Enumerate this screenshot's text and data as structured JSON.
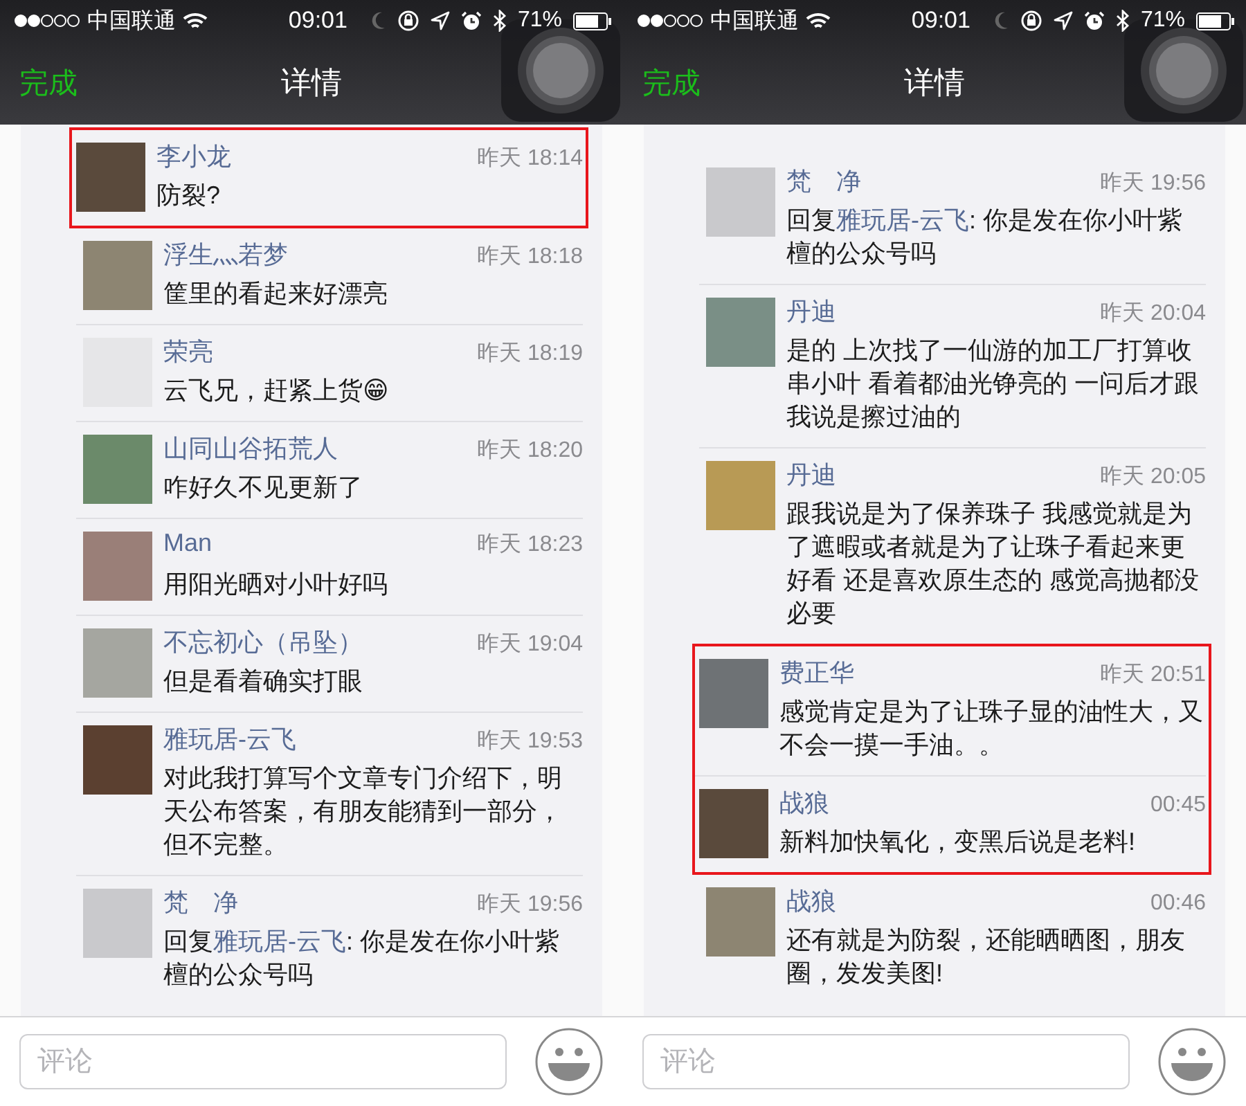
{
  "panels": [
    {
      "status_bar": {
        "carrier": "中国联通",
        "time": "09:01",
        "battery": "71%"
      },
      "nav": {
        "left": "完成",
        "title": "详情"
      },
      "comments": [
        {
          "name": "李小龙",
          "time": "昨天 18:14",
          "text": "防裂?",
          "highlighted": true
        },
        {
          "name": "浮生灬若梦",
          "time": "昨天 18:18",
          "text": "筐里的看起来好漂亮",
          "highlighted": false
        },
        {
          "name": "荣亮",
          "time": "昨天 18:19",
          "text": "云飞兄，赶紧上货😁",
          "highlighted": false
        },
        {
          "name": "山同山谷拓荒人",
          "time": "昨天 18:20",
          "text": "咋好久不见更新了",
          "highlighted": false
        },
        {
          "name": "Man",
          "time": "昨天 18:23",
          "text": "用阳光晒对小叶好吗",
          "highlighted": false
        },
        {
          "name": "不忘初心（吊坠）",
          "time": "昨天 19:04",
          "text": "但是看着确实打眼",
          "highlighted": false
        },
        {
          "name": "雅玩居-云飞",
          "time": "昨天 19:53",
          "text": "对此我打算写个文章专门介绍下，明天公布答案，有朋友能猜到一部分，但不完整。",
          "highlighted": false
        },
        {
          "name": "梵　净",
          "time": "昨天 19:56",
          "reply_prefix": "回复",
          "reply_to": "雅玩居-云飞",
          "text": ": 你是发在你小叶紫檀的公众号吗",
          "highlighted": false
        }
      ],
      "comment_field": {
        "placeholder": "评论"
      }
    },
    {
      "status_bar": {
        "carrier": "中国联通",
        "time": "09:01",
        "battery": "71%"
      },
      "nav": {
        "left": "完成",
        "title": "详情"
      },
      "comments": [
        {
          "name": "梵　净",
          "time": "昨天 19:56",
          "reply_prefix": "回复",
          "reply_to": "雅玩居-云飞",
          "text": ": 你是发在你小叶紫檀的公众号吗",
          "highlighted": false
        },
        {
          "name": "丹迪",
          "time": "昨天 20:04",
          "text": "是的 上次找了一仙游的加工厂打算收串小叶 看着都油光铮亮的 一问后才跟我说是擦过油的",
          "highlighted": false
        },
        {
          "name": "丹迪",
          "time": "昨天 20:05",
          "text": "跟我说是为了保养珠子 我感觉就是为了遮暇或者就是为了让珠子看起来更好看 还是喜欢原生态的 感觉高抛都没必要",
          "highlighted": false
        },
        {
          "name": "费正华",
          "time": "昨天 20:51",
          "text": "感觉肯定是为了让珠子显的油性大，又不会一摸一手油。。",
          "highlighted": true
        },
        {
          "name": "战狼",
          "time": "00:45",
          "text": "新料加快氧化，变黑后说是老料!",
          "highlighted": true
        },
        {
          "name": "战狼",
          "time": "00:46",
          "text": "还有就是为防裂，还能晒晒图，朋友圈，发发美图!",
          "highlighted": false
        }
      ],
      "comment_field": {
        "placeholder": "评论"
      }
    }
  ]
}
